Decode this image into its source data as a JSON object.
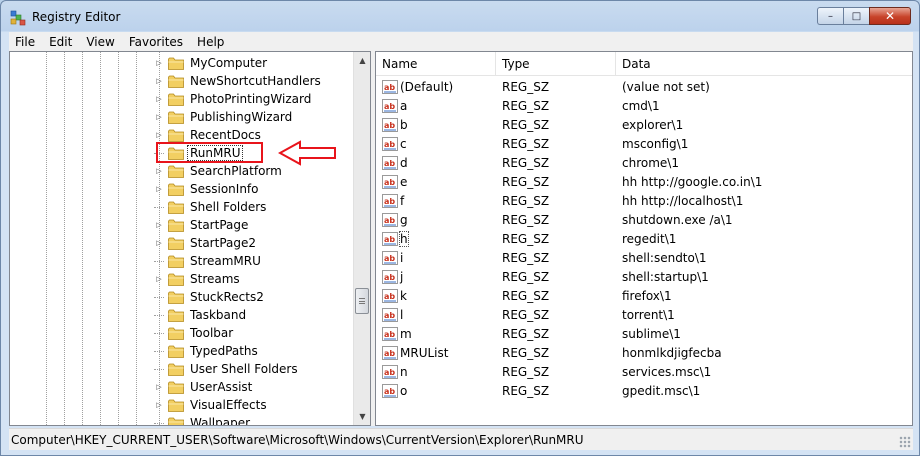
{
  "window": {
    "title": "Registry Editor",
    "icon": "registry-editor-icon"
  },
  "caption": {
    "minimize": "–",
    "maximize": "□",
    "close": "✕"
  },
  "menu": [
    "File",
    "Edit",
    "View",
    "Favorites",
    "Help"
  ],
  "tree": {
    "items": [
      {
        "label": "MyComputer",
        "expandable": true
      },
      {
        "label": "NewShortcutHandlers",
        "expandable": true
      },
      {
        "label": "PhotoPrintingWizard",
        "expandable": true
      },
      {
        "label": "PublishingWizard",
        "expandable": true
      },
      {
        "label": "RecentDocs",
        "expandable": true
      },
      {
        "label": "RunMRU",
        "expandable": false,
        "selected": true
      },
      {
        "label": "SearchPlatform",
        "expandable": true
      },
      {
        "label": "SessionInfo",
        "expandable": true
      },
      {
        "label": "Shell Folders",
        "expandable": false
      },
      {
        "label": "StartPage",
        "expandable": true
      },
      {
        "label": "StartPage2",
        "expandable": true
      },
      {
        "label": "StreamMRU",
        "expandable": false
      },
      {
        "label": "Streams",
        "expandable": true
      },
      {
        "label": "StuckRects2",
        "expandable": false
      },
      {
        "label": "Taskband",
        "expandable": false
      },
      {
        "label": "Toolbar",
        "expandable": false
      },
      {
        "label": "TypedPaths",
        "expandable": false
      },
      {
        "label": "User Shell Folders",
        "expandable": false
      },
      {
        "label": "UserAssist",
        "expandable": true
      },
      {
        "label": "VisualEffects",
        "expandable": true
      },
      {
        "label": "Wallpaper",
        "expandable": false
      }
    ]
  },
  "values": {
    "columns": {
      "name": "Name",
      "type": "Type",
      "data": "Data"
    },
    "rows": [
      {
        "name": "(Default)",
        "type": "REG_SZ",
        "data": "(value not set)"
      },
      {
        "name": "a",
        "type": "REG_SZ",
        "data": "cmd\\1"
      },
      {
        "name": "b",
        "type": "REG_SZ",
        "data": "explorer\\1"
      },
      {
        "name": "c",
        "type": "REG_SZ",
        "data": "msconfig\\1"
      },
      {
        "name": "d",
        "type": "REG_SZ",
        "data": "chrome\\1"
      },
      {
        "name": "e",
        "type": "REG_SZ",
        "data": "hh http://google.co.in\\1"
      },
      {
        "name": "f",
        "type": "REG_SZ",
        "data": "hh http://localhost\\1"
      },
      {
        "name": "g",
        "type": "REG_SZ",
        "data": "shutdown.exe /a\\1"
      },
      {
        "name": "h",
        "type": "REG_SZ",
        "data": "regedit\\1",
        "focused": true
      },
      {
        "name": "i",
        "type": "REG_SZ",
        "data": "shell:sendto\\1"
      },
      {
        "name": "j",
        "type": "REG_SZ",
        "data": "shell:startup\\1"
      },
      {
        "name": "k",
        "type": "REG_SZ",
        "data": "firefox\\1"
      },
      {
        "name": "l",
        "type": "REG_SZ",
        "data": "torrent\\1"
      },
      {
        "name": "m",
        "type": "REG_SZ",
        "data": "sublime\\1"
      },
      {
        "name": "MRUList",
        "type": "REG_SZ",
        "data": "honmlkdjigfecba"
      },
      {
        "name": "n",
        "type": "REG_SZ",
        "data": "services.msc\\1"
      },
      {
        "name": "o",
        "type": "REG_SZ",
        "data": "gpedit.msc\\1"
      }
    ]
  },
  "status": {
    "path": "Computer\\HKEY_CURRENT_USER\\Software\\Microsoft\\Windows\\CurrentVersion\\Explorer\\RunMRU"
  },
  "annotation": {
    "color": "#e8141b"
  }
}
